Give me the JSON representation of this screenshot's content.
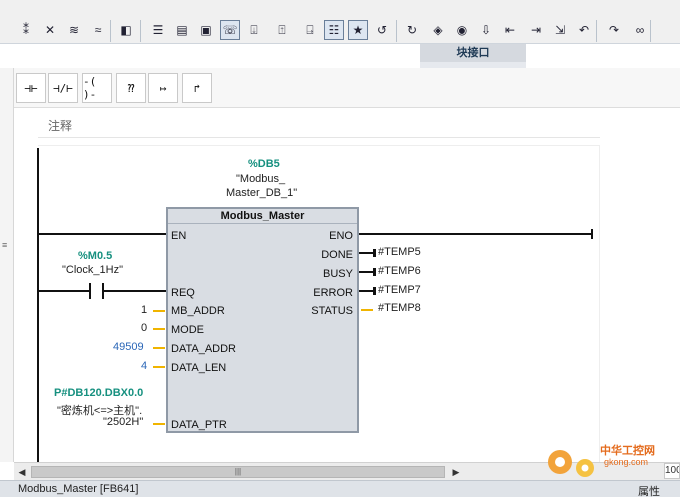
{
  "toolbar": {
    "buttons": [
      {
        "icon": "insert-network-icon",
        "glyph": "⁑"
      },
      {
        "icon": "delete-network-icon",
        "glyph": "✕"
      },
      {
        "icon": "expand-networks-icon",
        "glyph": "≋"
      },
      {
        "icon": "collapse-networks-icon",
        "glyph": "≈"
      },
      {
        "icon": "monitor-icon",
        "glyph": "◧"
      },
      {
        "icon": "list-view-icon",
        "glyph": "☰"
      },
      {
        "icon": "ladder-view-icon",
        "glyph": "▤"
      },
      {
        "icon": "fbd-view-icon",
        "glyph": "▣"
      },
      {
        "icon": "comment-toggle-icon",
        "glyph": "☏"
      },
      {
        "icon": "symbol-info-icon",
        "glyph": "⍗"
      },
      {
        "icon": "absolute-address-icon",
        "glyph": "⍐"
      },
      {
        "icon": "network-sort-icon",
        "glyph": "⍈"
      },
      {
        "icon": "favorites-icon",
        "glyph": "☷"
      },
      {
        "icon": "star-icon",
        "glyph": "★"
      },
      {
        "icon": "go-online-icon",
        "glyph": "↺"
      },
      {
        "icon": "go-offline-icon",
        "glyph": "↻"
      },
      {
        "icon": "watch-icon",
        "glyph": "◈"
      },
      {
        "icon": "modify-icon",
        "glyph": "◉"
      },
      {
        "icon": "download-icon",
        "glyph": "⇩"
      },
      {
        "icon": "jump-back-icon",
        "glyph": "⇤"
      },
      {
        "icon": "step-over-icon",
        "glyph": "⇥"
      },
      {
        "icon": "step-into-icon",
        "glyph": "⇲"
      },
      {
        "icon": "undo-icon",
        "glyph": "↶"
      },
      {
        "icon": "redo-icon",
        "glyph": "↷"
      },
      {
        "icon": "monitoring-glasses-icon",
        "glyph": "∞"
      }
    ],
    "panel_title": "块接口"
  },
  "ladder_elements": [
    {
      "icon": "no-contact-icon",
      "glyph": "⊣⊢"
    },
    {
      "icon": "nc-contact-icon",
      "glyph": "⊣/⊢"
    },
    {
      "icon": "coil-icon",
      "glyph": "-( )-"
    },
    {
      "icon": "empty-box-icon",
      "glyph": "⁇"
    },
    {
      "icon": "open-branch-icon",
      "glyph": "↦"
    },
    {
      "icon": "close-branch-icon",
      "glyph": "↱"
    }
  ],
  "network": {
    "comment_label": "注释",
    "instance_db": {
      "address": "%DB5",
      "name_line1": "\"Modbus_",
      "name_line2": "Master_DB_1\""
    },
    "block": {
      "title": "Modbus_Master",
      "inputs": [
        "EN",
        "REQ",
        "MB_ADDR",
        "MODE",
        "DATA_ADDR",
        "DATA_LEN",
        "DATA_PTR"
      ],
      "outputs": [
        "ENO",
        "DONE",
        "BUSY",
        "ERROR",
        "STATUS"
      ]
    },
    "req_contact": {
      "address": "%M0.5",
      "symbol": "\"Clock_1Hz\""
    },
    "input_values": {
      "mb_addr": "1",
      "mode": "0",
      "data_addr": "49509",
      "data_len": "4"
    },
    "data_ptr": {
      "address": "P#DB120.DBX0.0",
      "symbol_line1": "\"密炼机<=>主机\".",
      "symbol_line2": "\"2502H\""
    },
    "output_values": {
      "done": "#TEMP5",
      "busy": "#TEMP6",
      "error": "#TEMP7",
      "status": "#TEMP8"
    }
  },
  "scrollbar": {
    "thumb_label": "|||",
    "zoom_value": "100"
  },
  "status_bar": {
    "title": "Modbus_Master [FB641]",
    "right_label": "属性"
  },
  "watermark": {
    "line1": "中华工控网",
    "line2": "gkong.com"
  },
  "colors": {
    "accent_teal": "#16907f",
    "value_blue": "#2a66b7",
    "wire_yellow": "#f0b400",
    "block_fill": "#d9dde3"
  }
}
